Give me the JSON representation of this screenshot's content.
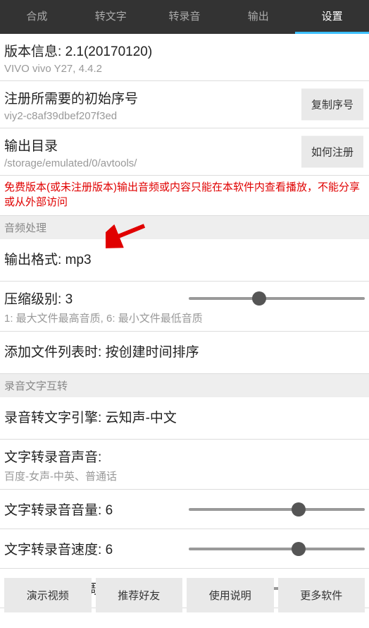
{
  "tabs": [
    "合成",
    "转文字",
    "转录音",
    "输出",
    "设置"
  ],
  "active_tab_index": 4,
  "version": {
    "title_prefix": "版本信息: ",
    "version_string": "2.1(20170120)",
    "device": "VIVO vivo Y27, 4.4.2"
  },
  "register": {
    "title": "注册所需要的初始序号",
    "serial": "viy2-c8af39dbef207f3ed",
    "copy_btn": "复制序号"
  },
  "output_dir": {
    "title": "输出目录",
    "path": "/storage/emulated/0/avtools/",
    "help_btn": "如何注册"
  },
  "red_note": "免费版本(或未注册版本)输出音频或内容只能在本软件内查看播放，不能分享或从外部访问",
  "audio_header": "音频处理",
  "output_format": {
    "label": "输出格式: ",
    "value": "mp3"
  },
  "compress": {
    "label": "压缩级别: ",
    "value": 3,
    "sub": "1: 最大文件最高音质, 6: 最小文件最低音质",
    "min": 1,
    "max": 6
  },
  "add_list": {
    "label": "添加文件列表时: ",
    "value": "按创建时间排序"
  },
  "stt_header": "录音文字互转",
  "stt_engine": {
    "label": "录音转文字引擎: ",
    "value": "云知声-中文"
  },
  "tts_voice": {
    "label": "文字转录音声音:",
    "sub": "百度-女声-中英、普通话"
  },
  "tts_volume": {
    "label": "文字转录音音量: ",
    "value": 6,
    "min": 1,
    "max": 9
  },
  "tts_speed": {
    "label": "文字转录音速度: ",
    "value": 6,
    "min": 1,
    "max": 9
  },
  "tts_pitch": {
    "label": "文字转录音音调: ",
    "value": 6,
    "min": 1,
    "max": 9
  },
  "bottom_buttons": [
    "演示视频",
    "推荐好友",
    "使用说明",
    "更多软件"
  ]
}
